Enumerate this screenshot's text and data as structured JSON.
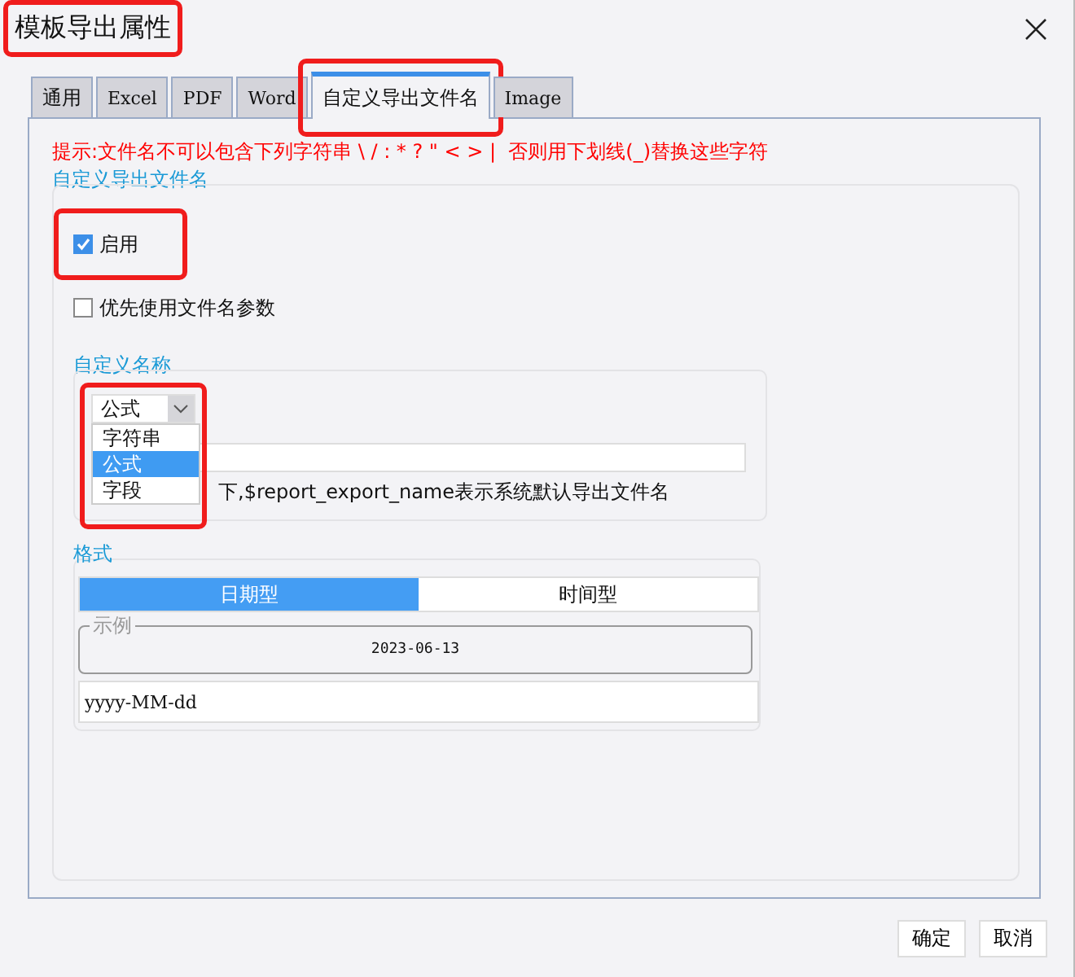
{
  "window": {
    "title": "模板导出属性",
    "highlighted": true
  },
  "tabs": [
    {
      "label": "通用",
      "selected": false,
      "highlighted": false
    },
    {
      "label": "Excel",
      "selected": false,
      "highlighted": false
    },
    {
      "label": "PDF",
      "selected": false,
      "highlighted": false
    },
    {
      "label": "Word",
      "selected": false,
      "highlighted": false
    },
    {
      "label": "自定义导出文件名",
      "selected": true,
      "highlighted": true
    },
    {
      "label": "Image",
      "selected": false,
      "highlighted": false
    }
  ],
  "notice": "提示:文件名不可以包含下列字符串 \\ / : * ? \" < > |  否则用下划线(_)替换这些字符",
  "group": {
    "title": "自定义导出文件名",
    "options": [
      {
        "label": "启用",
        "checked": true,
        "highlighted": true
      },
      {
        "label": "优先使用文件名参数",
        "checked": false,
        "highlighted": false
      }
    ],
    "custom_name": {
      "title": "自定义名称",
      "dropdown": {
        "value": "公式",
        "highlighted": true,
        "expanded": true,
        "items": [
          {
            "label": "字符串",
            "selected": false
          },
          {
            "label": "公式",
            "selected": true
          },
          {
            "label": "字段",
            "selected": false
          }
        ]
      },
      "hint_end": "下,$report_export_name表示系统默认导出文件名"
    },
    "format": {
      "title": "格式",
      "types": [
        {
          "label": "日期型",
          "selected": true
        },
        {
          "label": "时间型",
          "selected": false
        }
      ],
      "example_title": "示例",
      "example": "2023-06-13",
      "pattern": "yyyy-MM-dd"
    }
  },
  "buttons": [
    "确定",
    "取消"
  ]
}
